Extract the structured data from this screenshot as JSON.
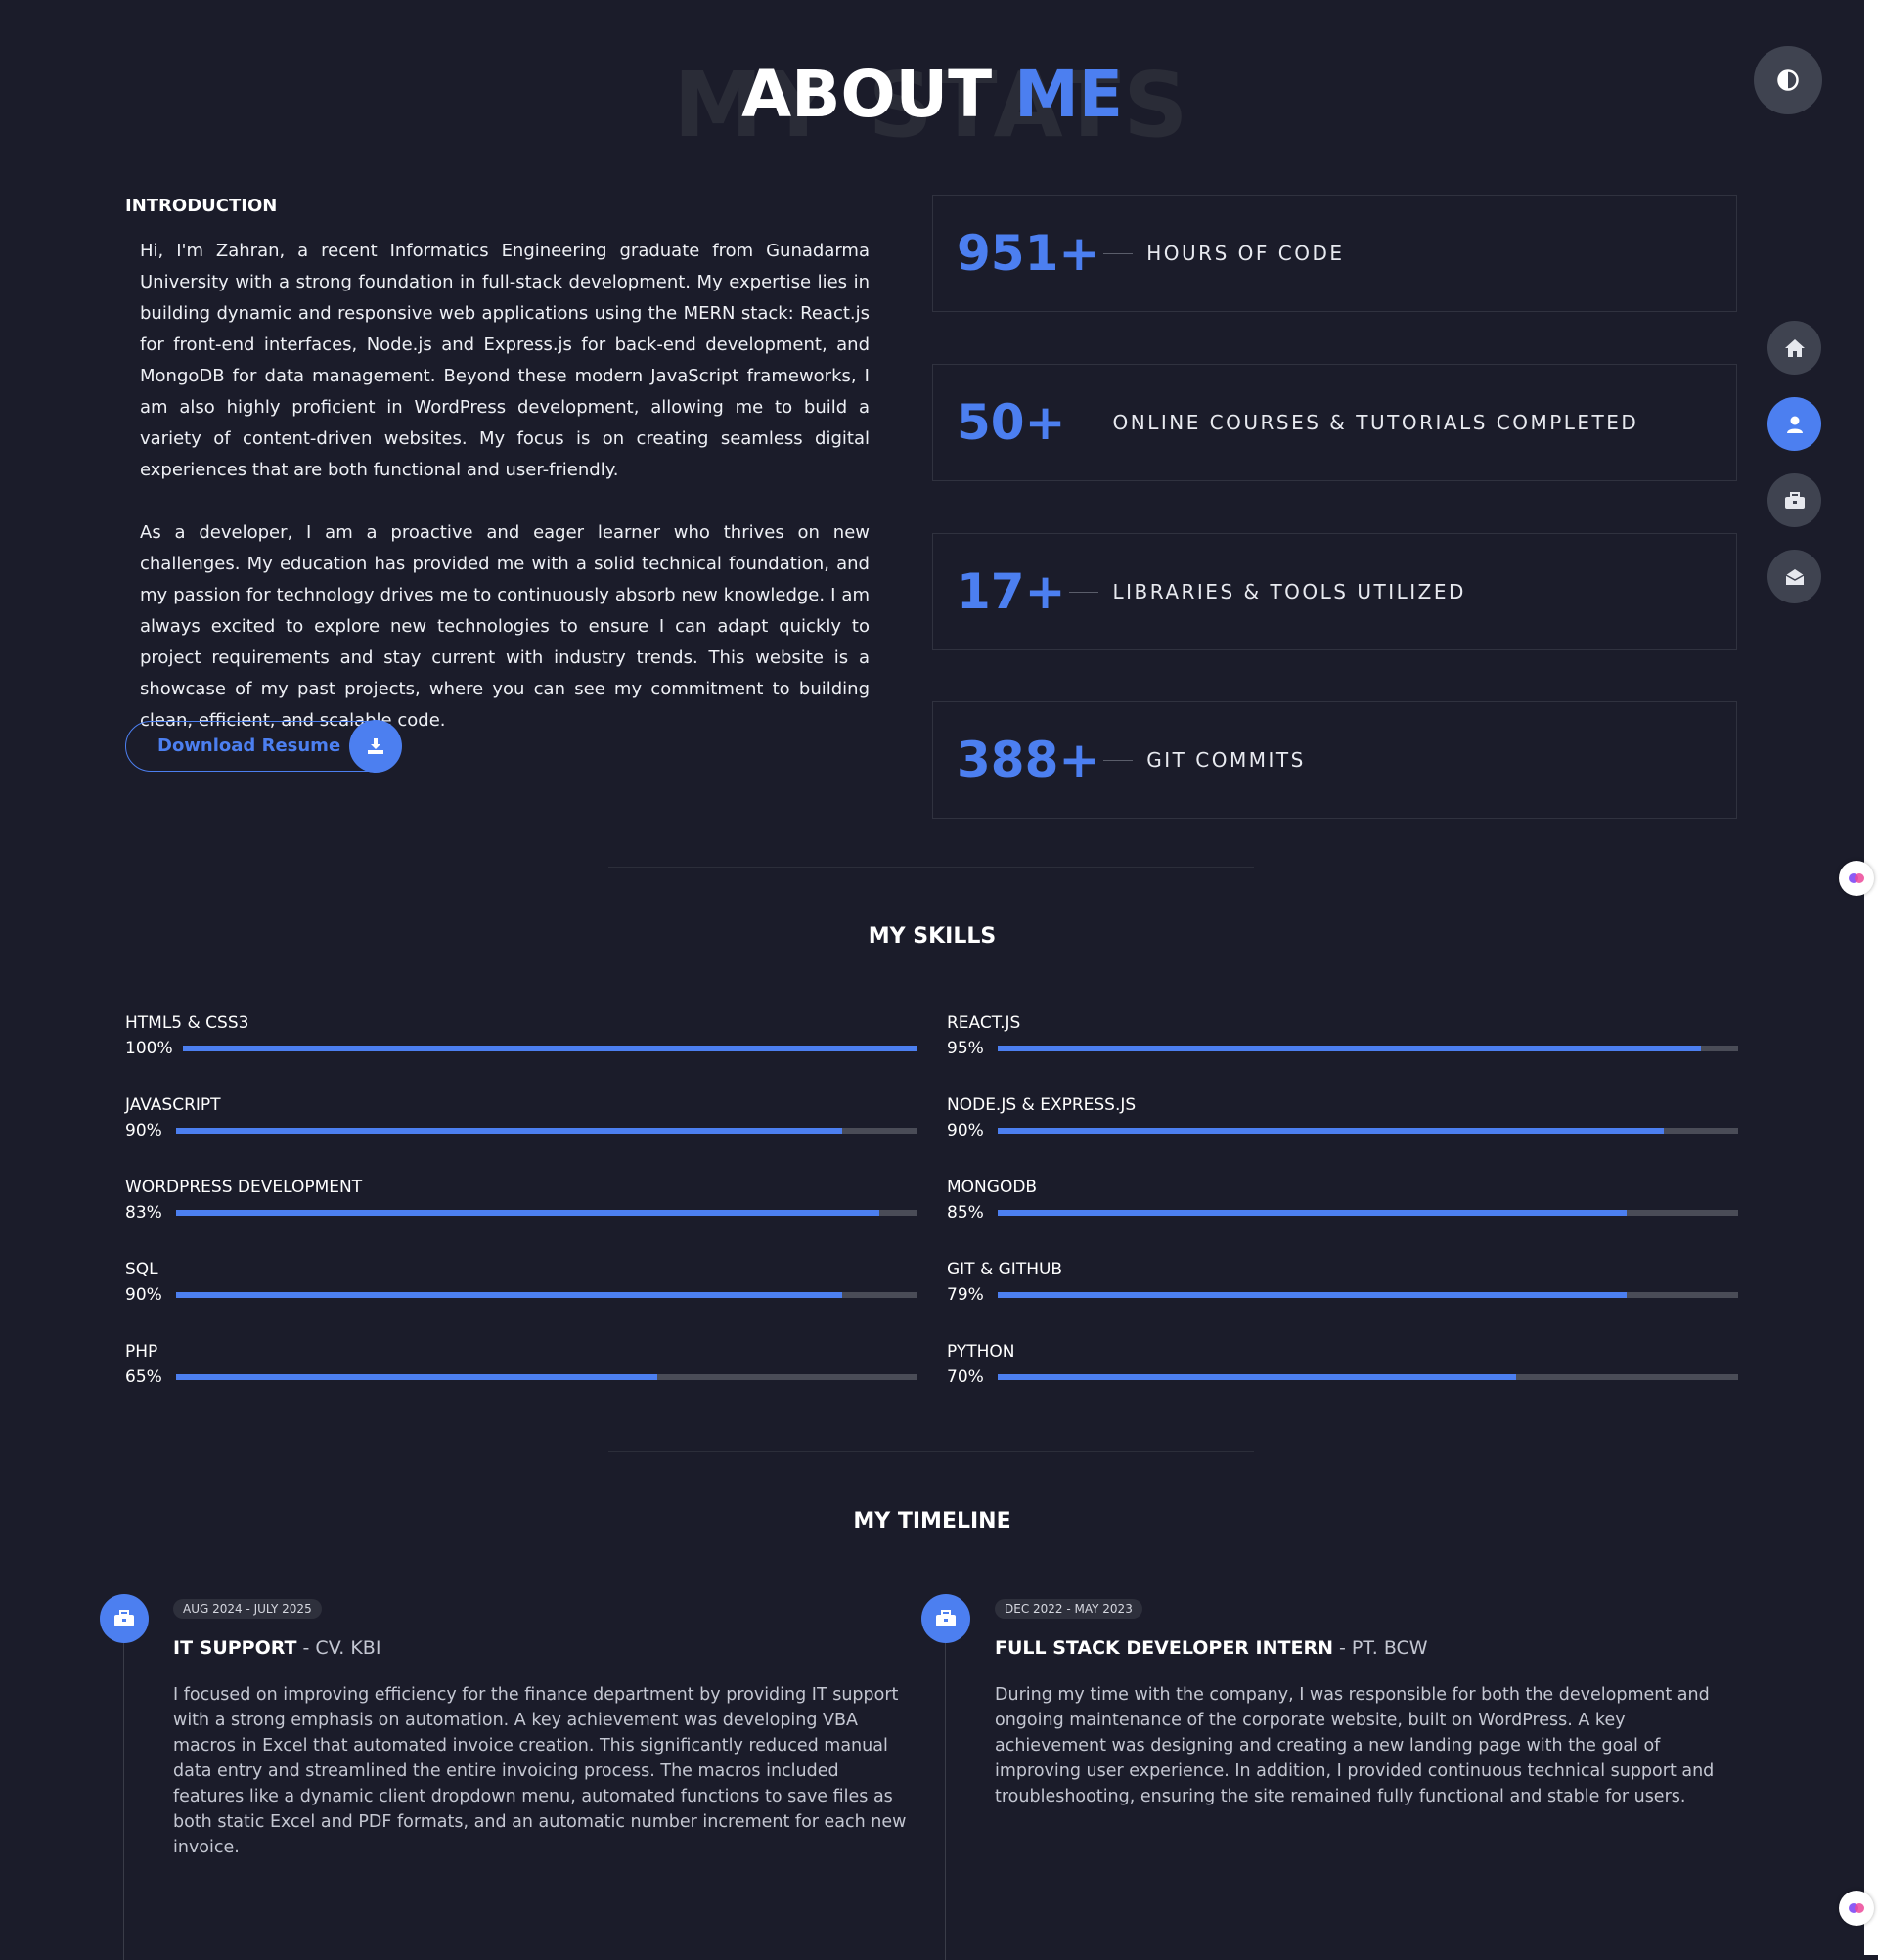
{
  "header": {
    "bg_title": "MY STATS",
    "title_main": "ABOUT",
    "title_accent": "ME"
  },
  "theme_toggle": {
    "icon": "contrast-icon"
  },
  "side_nav": [
    {
      "name": "home",
      "icon": "home-icon",
      "active": false
    },
    {
      "name": "about",
      "icon": "user-icon",
      "active": true
    },
    {
      "name": "portfolio",
      "icon": "briefcase-icon",
      "active": false
    },
    {
      "name": "contact",
      "icon": "envelope-icon",
      "active": false
    }
  ],
  "introduction": {
    "heading": "INTRODUCTION",
    "paragraph1": "Hi, I'm Zahran, a recent Informatics Engineering graduate from Gunadarma University with a strong foundation in full-stack development. My expertise lies in building dynamic and responsive web applications using the MERN stack: React.js for front-end interfaces, Node.js and Express.js for back-end development, and MongoDB for data management. Beyond these modern JavaScript frameworks, I am also highly proficient in WordPress development, allowing me to build a variety of content-driven websites. My focus is on creating seamless digital experiences that are both functional and user-friendly.",
    "paragraph2": "As a developer, I am a proactive and eager learner who thrives on new challenges. My education has provided me with a solid technical foundation, and my passion for technology drives me to continuously absorb new knowledge. I am always excited to explore new technologies to ensure I can adapt quickly to project requirements and stay current with industry trends. This website is a showcase of my past projects, where you can see my commitment to building clean, efficient, and scalable code.",
    "download_label": "Download Resume"
  },
  "stats": [
    {
      "value": "951+",
      "label": "HOURS OF CODE"
    },
    {
      "value": "50+",
      "label": "ONLINE COURSES & TUTORIALS COMPLETED"
    },
    {
      "value": "17+",
      "label": "LIBRARIES & TOOLS UTILIZED"
    },
    {
      "value": "388+",
      "label": "GIT COMMITS"
    }
  ],
  "skills": {
    "title": "MY SKILLS",
    "left": [
      {
        "name": "HTML5 & CSS3",
        "percent_label": "100%",
        "fill": 1.0
      },
      {
        "name": "JAVASCRIPT",
        "percent_label": "90%",
        "fill": 0.9
      },
      {
        "name": "WORDPRESS DEVELOPMENT",
        "percent_label": "83%",
        "fill": 0.95
      },
      {
        "name": "SQL",
        "percent_label": "90%",
        "fill": 0.9
      },
      {
        "name": "PHP",
        "percent_label": "65%",
        "fill": 0.65
      }
    ],
    "right": [
      {
        "name": "REACT.JS",
        "percent_label": "95%",
        "fill": 0.95
      },
      {
        "name": "NODE.JS & EXPRESS.JS",
        "percent_label": "90%",
        "fill": 0.9
      },
      {
        "name": "MONGODB",
        "percent_label": "85%",
        "fill": 0.85
      },
      {
        "name": "GIT & GITHUB",
        "percent_label": "79%",
        "fill": 0.85
      },
      {
        "name": "PYTHON",
        "percent_label": "70%",
        "fill": 0.7
      }
    ],
    "colors": {
      "fill": "#4c7ff0",
      "track": "#4a4c57"
    }
  },
  "timeline": {
    "title": "MY TIMELINE",
    "items": [
      {
        "date": "AUG 2024 - JULY 2025",
        "role": "IT SUPPORT",
        "company": " - CV. KBI",
        "description": "I focused on improving efficiency for the finance department by providing IT support with a strong emphasis on automation. A key achievement was developing VBA macros in Excel that automated invoice creation. This significantly reduced manual data entry and streamlined the entire invoicing process. The macros included features like a dynamic client dropdown menu, automated functions to save files as both static Excel and PDF formats, and an automatic number increment for each new invoice."
      },
      {
        "date": "DEC 2022 - MAY 2023",
        "role": "FULL STACK DEVELOPER INTERN",
        "company": " - PT. BCW",
        "description": "During my time with the company, I was responsible for both the development and ongoing maintenance of the corporate website, built on WordPress. A key achievement was designing and creating a new landing page with the goal of improving user experience. In addition, I provided continuous technical support and troubleshooting, ensuring the site remained fully functional and stable for users."
      }
    ]
  },
  "colors": {
    "accent": "#4c7ff0",
    "background": "#1b1c2a"
  }
}
